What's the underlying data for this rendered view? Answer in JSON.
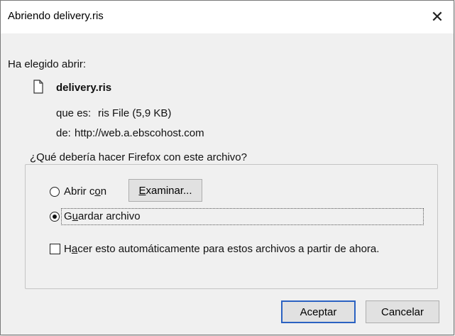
{
  "window": {
    "title": "Abriendo delivery.ris",
    "close_glyph": "✕"
  },
  "intro": "Ha elegido abrir:",
  "file": {
    "name": "delivery.ris",
    "type_label": "que es:",
    "type_value": "ris File (5,9 KB)",
    "from_label": "de:",
    "from_value": "http://web.a.ebscohost.com"
  },
  "question": {
    "legend": "¿Qué debería hacer Firefox con este archivo?",
    "open_with": {
      "pre": "Abrir c",
      "accel": "o",
      "post": "n",
      "selected": false
    },
    "browse_button": {
      "pre": "",
      "accel": "E",
      "post": "xaminar..."
    },
    "save_file": {
      "pre": "G",
      "accel": "u",
      "post": "ardar archivo",
      "selected": true
    },
    "auto": {
      "pre": "H",
      "accel": "a",
      "post": "cer esto automáticamente para estos archivos a partir de ahora.",
      "checked": false
    }
  },
  "buttons": {
    "ok": "Aceptar",
    "cancel": "Cancelar"
  }
}
